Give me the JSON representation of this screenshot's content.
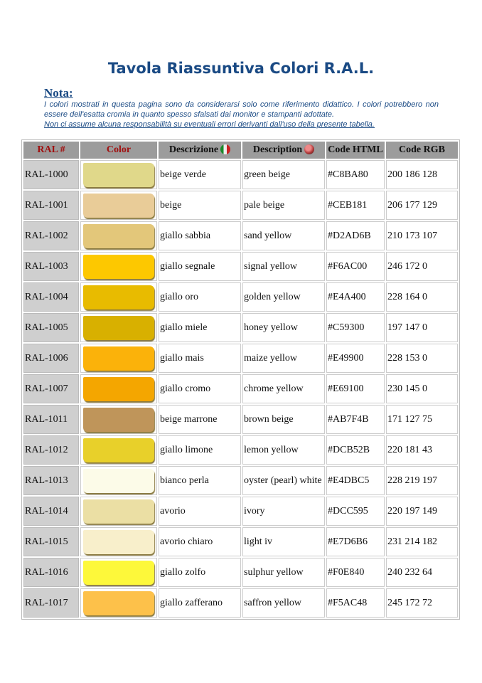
{
  "title": "Tavola Riassuntiva Colori R.A.L.",
  "nota": {
    "label": "Nota:",
    "line1": "I colori mostrati in questa pagina sono da considerarsi solo come riferimento didattico.  I colori potrebbero non essere dell'esatta cromia in quanto spesso sfalsati dai monitor e stampanti adottate.",
    "line2": "Non ci assume alcuna responsabilità su eventuali errori derivanti dall'uso della presente tabella."
  },
  "headers": [
    "RAL #",
    "Color",
    "Descrizione",
    "Description",
    "Code HTML",
    "Code RGB"
  ],
  "icons": {
    "it": "italy-flag-icon",
    "en": "uk-flag-icon"
  },
  "rows": [
    {
      "ral": "RAL-1000",
      "swatch": "#e0d88a",
      "it": "beige verde",
      "en": "green beige",
      "html": "#C8BA80",
      "rgb": "200 186 128"
    },
    {
      "ral": "RAL-1001",
      "swatch": "#e9cc98",
      "it": "beige",
      "en": "pale beige",
      "html": "#CEB181",
      "rgb": "206 177 129"
    },
    {
      "ral": "RAL-1002",
      "swatch": "#e3c77a",
      "it": "giallo sabbia",
      "en": "sand yellow",
      "html": "#D2AD6B",
      "rgb": "210 173 107"
    },
    {
      "ral": "RAL-1003",
      "swatch": "#fdc800",
      "it": "giallo segnale",
      "en": "signal yellow",
      "html": "#F6AC00",
      "rgb": "246 172 0"
    },
    {
      "ral": "RAL-1004",
      "swatch": "#e8bb00",
      "it": "giallo oro",
      "en": "golden yellow",
      "html": "#E4A400",
      "rgb": "228 164 0"
    },
    {
      "ral": "RAL-1005",
      "swatch": "#d8b000",
      "it": "giallo miele",
      "en": "honey yellow",
      "html": "#C59300",
      "rgb": "197 147 0"
    },
    {
      "ral": "RAL-1006",
      "swatch": "#fbb20a",
      "it": "giallo mais",
      "en": "maize yellow",
      "html": "#E49900",
      "rgb": "228 153 0"
    },
    {
      "ral": "RAL-1007",
      "swatch": "#f4a600",
      "it": "giallo cromo",
      "en": "chrome yellow",
      "html": "#E69100",
      "rgb": "230 145 0"
    },
    {
      "ral": "RAL-1011",
      "swatch": "#bf955a",
      "it": "beige marrone",
      "en": "brown beige",
      "html": "#AB7F4B",
      "rgb": "171 127 75"
    },
    {
      "ral": "RAL-1012",
      "swatch": "#e8d02a",
      "it": "giallo limone",
      "en": "lemon yellow",
      "html": "#DCB52B",
      "rgb": "220 181 43"
    },
    {
      "ral": "RAL-1013",
      "swatch": "#fcfbe8",
      "it": "bianco perla",
      "en": "oyster (pearl) white",
      "html": "#E4DBC5",
      "rgb": "228 219 197"
    },
    {
      "ral": "RAL-1014",
      "swatch": "#ebdfa4",
      "it": "avorio",
      "en": "ivory",
      "html": "#DCC595",
      "rgb": "220 197 149"
    },
    {
      "ral": "RAL-1015",
      "swatch": "#f8efcb",
      "it": "avorio chiaro",
      "en": "light iv",
      "html": "#E7D6B6",
      "rgb": "231 214 182"
    },
    {
      "ral": "RAL-1016",
      "swatch": "#fdf83a",
      "it": "giallo zolfo",
      "en": "sulphur yellow",
      "html": "#F0E840",
      "rgb": "240 232 64"
    },
    {
      "ral": "RAL-1017",
      "swatch": "#fdc14a",
      "it": "giallo zafferano",
      "en": "saffron yellow",
      "html": "#F5AC48",
      "rgb": "245 172 72"
    }
  ]
}
